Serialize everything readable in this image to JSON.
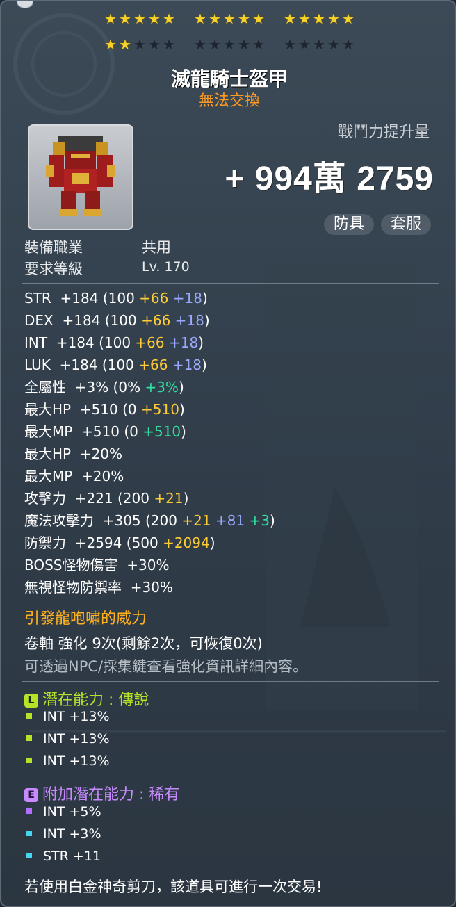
{
  "stars": {
    "row1": [
      true,
      true,
      true,
      true,
      true,
      true,
      true,
      true,
      true,
      true,
      true,
      true,
      true,
      true,
      true
    ],
    "row2": [
      true,
      true,
      false,
      false,
      false,
      false,
      false,
      false,
      false,
      false,
      false,
      false,
      false,
      false,
      false
    ]
  },
  "item": {
    "name": "滅龍騎士盔甲",
    "trade_status": "無法交換",
    "cp_label": "戰鬥力提升量",
    "cp_value": "+ 994萬 2759",
    "tags": [
      "防具",
      "套服"
    ],
    "job_label": "裝備職業",
    "job_value": "共用",
    "level_label": "要求等級",
    "level_value": "Lv. 170"
  },
  "stats": [
    {
      "name": "STR",
      "parts": [
        {
          "t": "  +184 (100 ",
          "c": ""
        },
        {
          "t": "+66",
          "c": "y"
        },
        {
          "t": " ",
          "c": ""
        },
        {
          "t": "+18",
          "c": "b"
        },
        {
          "t": ")",
          "c": ""
        }
      ]
    },
    {
      "name": "DEX",
      "parts": [
        {
          "t": "  +184 (100 ",
          "c": ""
        },
        {
          "t": "+66",
          "c": "y"
        },
        {
          "t": " ",
          "c": ""
        },
        {
          "t": "+18",
          "c": "b"
        },
        {
          "t": ")",
          "c": ""
        }
      ]
    },
    {
      "name": "INT",
      "parts": [
        {
          "t": "  +184 (100 ",
          "c": ""
        },
        {
          "t": "+66",
          "c": "y"
        },
        {
          "t": " ",
          "c": ""
        },
        {
          "t": "+18",
          "c": "b"
        },
        {
          "t": ")",
          "c": ""
        }
      ]
    },
    {
      "name": "LUK",
      "parts": [
        {
          "t": "  +184 (100 ",
          "c": ""
        },
        {
          "t": "+66",
          "c": "y"
        },
        {
          "t": " ",
          "c": ""
        },
        {
          "t": "+18",
          "c": "b"
        },
        {
          "t": ")",
          "c": ""
        }
      ]
    },
    {
      "name": "全屬性",
      "parts": [
        {
          "t": "  +3% (0% ",
          "c": ""
        },
        {
          "t": "+3%",
          "c": "g"
        },
        {
          "t": ")",
          "c": ""
        }
      ]
    },
    {
      "name": "最大HP",
      "parts": [
        {
          "t": "  +510 (0 ",
          "c": ""
        },
        {
          "t": "+510",
          "c": "y"
        },
        {
          "t": ")",
          "c": ""
        }
      ]
    },
    {
      "name": "最大MP",
      "parts": [
        {
          "t": "  +510 (0 ",
          "c": ""
        },
        {
          "t": "+510",
          "c": "g"
        },
        {
          "t": ")",
          "c": ""
        }
      ]
    },
    {
      "name": "最大HP",
      "parts": [
        {
          "t": "  +20%",
          "c": ""
        }
      ]
    },
    {
      "name": "最大MP",
      "parts": [
        {
          "t": "  +20%",
          "c": ""
        }
      ]
    },
    {
      "name": "攻擊力",
      "parts": [
        {
          "t": "  +221 (200 ",
          "c": ""
        },
        {
          "t": "+21",
          "c": "y"
        },
        {
          "t": ")",
          "c": ""
        }
      ]
    },
    {
      "name": "魔法攻擊力",
      "parts": [
        {
          "t": "  +305 (200 ",
          "c": ""
        },
        {
          "t": "+21",
          "c": "y"
        },
        {
          "t": " ",
          "c": ""
        },
        {
          "t": "+81",
          "c": "b"
        },
        {
          "t": " ",
          "c": ""
        },
        {
          "t": "+3",
          "c": "g"
        },
        {
          "t": ")",
          "c": ""
        }
      ]
    },
    {
      "name": "防禦力",
      "parts": [
        {
          "t": "  +2594 (500 ",
          "c": ""
        },
        {
          "t": "+2094",
          "c": "y"
        },
        {
          "t": ")",
          "c": ""
        }
      ]
    },
    {
      "name": "BOSS怪物傷害",
      "parts": [
        {
          "t": "  +30%",
          "c": ""
        }
      ]
    },
    {
      "name": "無視怪物防禦率",
      "parts": [
        {
          "t": "  +30%",
          "c": ""
        }
      ]
    }
  ],
  "set_effect": "引發龍咆嘯的威力",
  "scroll_info": "卷軸 強化 9次(剩餘2次，可恢復0次)",
  "npc_hint": "可透過NPC/採集鍵查看強化資訊詳細內容。",
  "potential": {
    "icon": "L",
    "title": "潛在能力 : 傳說",
    "color": "#b8e22a",
    "lines": [
      "INT +13%",
      "INT +13%",
      "INT +13%"
    ]
  },
  "additional": {
    "icon": "E",
    "title": "附加潛在能力 : 稀有",
    "color": "#c78bff",
    "lines": [
      {
        "text": "INT +5%",
        "bullet": "#b36dff"
      },
      {
        "text": "INT +3%",
        "bullet": "#46d6f0"
      },
      {
        "text": "STR +11",
        "bullet": "#46d6f0"
      }
    ]
  },
  "footer": "若使用白金神奇剪刀，該道具可進行一次交易!"
}
